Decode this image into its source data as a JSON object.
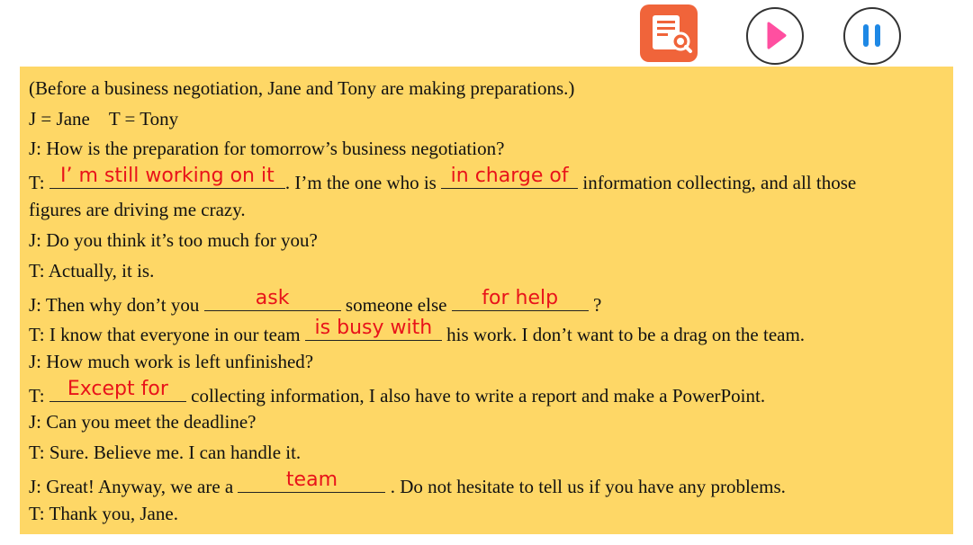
{
  "toolbar": {
    "book_icon": "book-search-icon",
    "play_icon": "play-icon",
    "pause_icon": "pause-icon",
    "colors": {
      "book_bg": "#f0643a",
      "play": "#ff4fa0",
      "pause": "#1e88e5"
    }
  },
  "dialogue": {
    "colors": {
      "panel_bg": "#fed766",
      "answer": "#e8131a"
    },
    "intro": "(Before a business negotiation, Jane and Tony are making preparations.)",
    "roles": "J = Jane    T = Tony",
    "l3": "J: How is the preparation for tomorrow’s business negotiation?",
    "l4": {
      "prefix": "T: ",
      "answer1": "I’ m still working on it",
      "mid": ". I’m the one who is ",
      "answer2": "in charge of",
      "suffix": " information collecting, and all those"
    },
    "l5": "figures are driving me crazy.",
    "l6": "J: Do you think it’s too much for you?",
    "l7": "T: Actually, it is.",
    "l8": {
      "prefix": "J: Then why don’t you ",
      "answer1": "ask",
      "mid": " someone else ",
      "answer2": "for help",
      "suffix": " ?"
    },
    "l9": {
      "prefix": "T: I know that everyone in our team ",
      "answer1": "is busy with",
      "suffix": " his work. I don’t want to be a drag on the team."
    },
    "l10": "J: How much work is left unfinished?",
    "l11": {
      "prefix": "T: ",
      "answer1": "Except for",
      "suffix": " collecting information, I also have to write a report and make a PowerPoint."
    },
    "l12": "J: Can you meet the deadline?",
    "l13": "T: Sure. Believe me. I can handle it.",
    "l14": {
      "prefix": "J: Great! Anyway, we are a ",
      "answer1": "team",
      "suffix": " . Do not hesitate to tell us if you have any problems."
    },
    "l15": "T: Thank you, Jane."
  }
}
